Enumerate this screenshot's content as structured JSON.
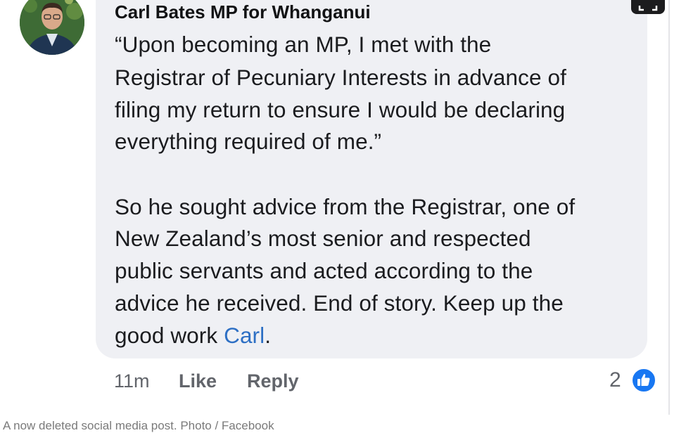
{
  "comment": {
    "author": "Carl Bates MP for Whanganui",
    "lines": [
      "“Upon becoming an MP, I met with the",
      "Registrar of Pecuniary Interests in advance of",
      "filing my return to ensure I would be declaring",
      "everything required of me.”",
      "So he sought advice from the Registrar, one of",
      "New Zealand’s most senior and respected",
      "public servants and acted according to the",
      "advice he received. End of story. Keep up the",
      "good work "
    ],
    "mention": "Carl",
    "trailing": ".",
    "timestamp": "11m",
    "like_label": "Like",
    "reply_label": "Reply",
    "reaction_count": "2"
  },
  "caption": "A now deleted social media post. Photo / Facebook",
  "colors": {
    "bubble": "#eff0f4",
    "mention": "#2d6fc4",
    "like_badge": "#1877f2"
  },
  "icons": {
    "expand": "expand-icon",
    "like": "thumbs-up-icon"
  }
}
